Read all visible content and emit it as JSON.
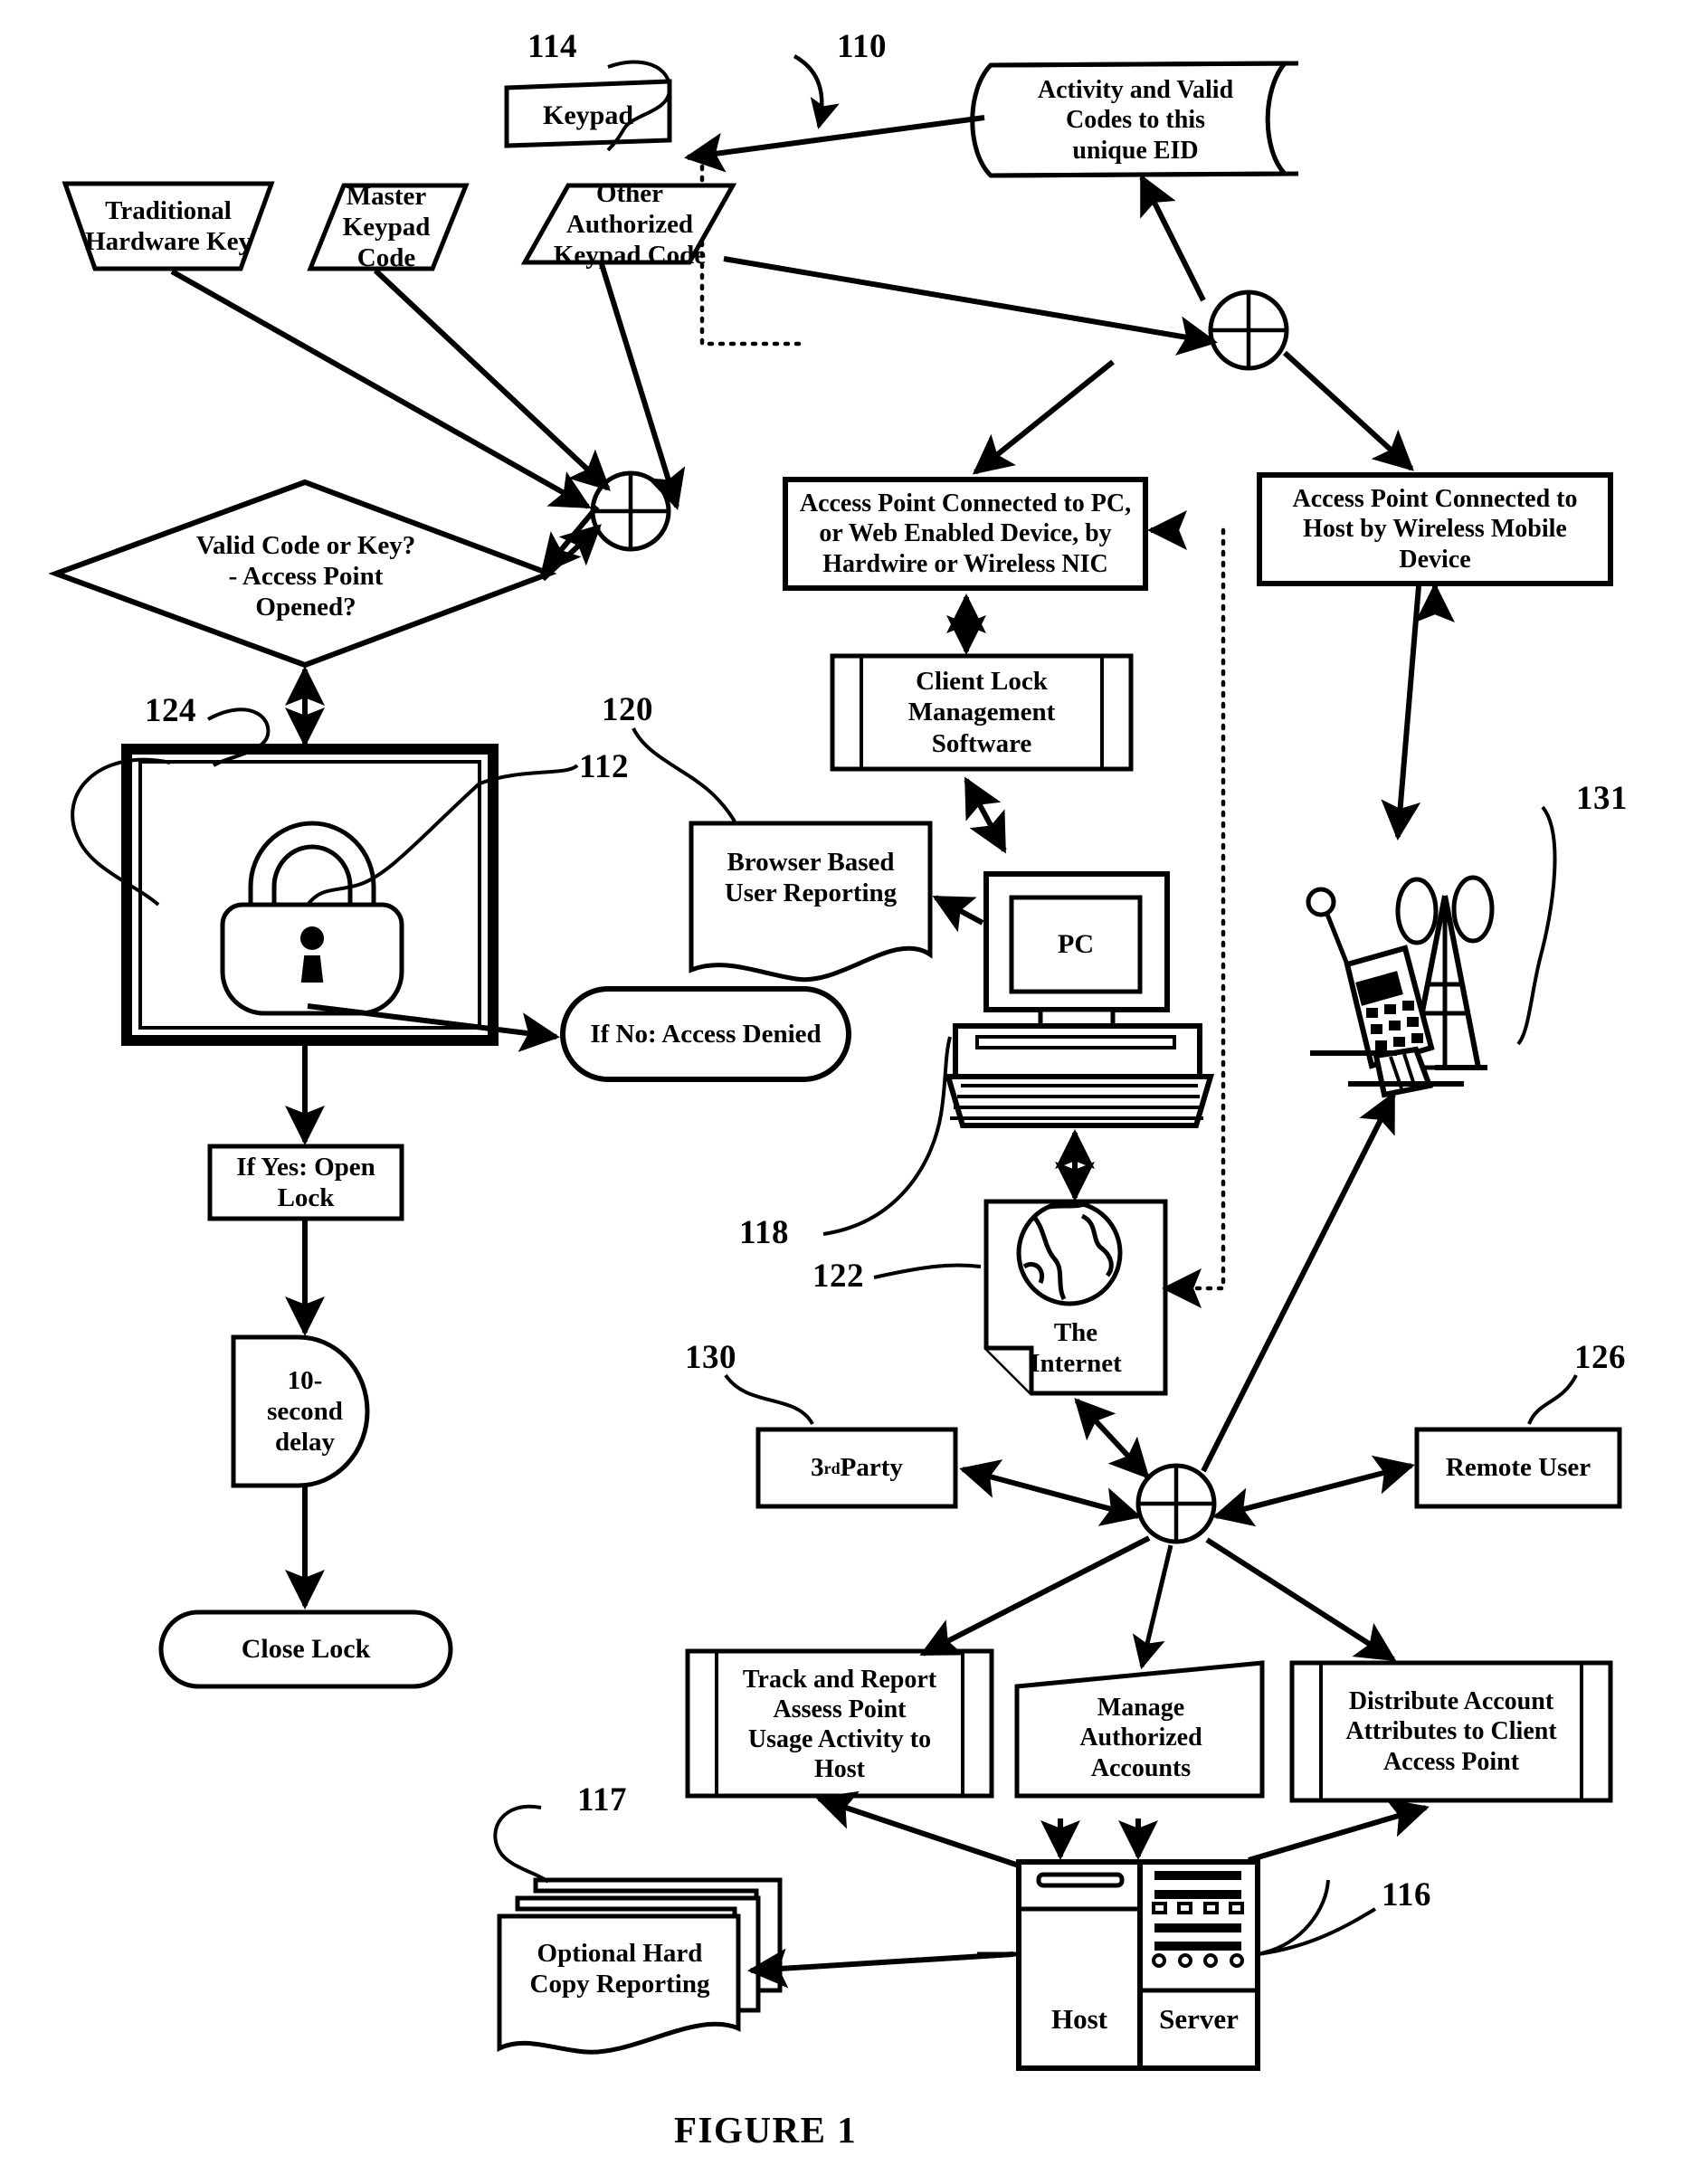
{
  "figure": {
    "caption": "FIGURE 1",
    "title": "Access point lock control and reporting system flow diagram"
  },
  "nodes": {
    "keypad": {
      "label": "Keypad",
      "shape": "skewed-box"
    },
    "activity_codes": {
      "label": "Activity and Valid\nCodes to this\nunique EID",
      "shape": "stored-data"
    },
    "traditional_key": {
      "label": "Traditional\nHardware Key",
      "shape": "trapezoid"
    },
    "master_code": {
      "label": "Master\nKeypad\nCode",
      "shape": "parallelogram"
    },
    "other_code": {
      "label": "Other\nAuthorized\nKeypad Code",
      "shape": "parallelogram"
    },
    "valid_decision": {
      "label": "Valid Code or Key?\n- Access Point\nOpened?",
      "shape": "diamond"
    },
    "lock_box": {
      "label": "",
      "shape": "double-box-with-padlock"
    },
    "access_denied": {
      "label": "If No: Access Denied",
      "shape": "stadium"
    },
    "open_lock": {
      "label": "If Yes: Open\nLock",
      "shape": "rect"
    },
    "delay": {
      "label": "10-\nsecond\ndelay",
      "shape": "delay"
    },
    "close_lock": {
      "label": "Close Lock",
      "shape": "stadium"
    },
    "ap_pc": {
      "label": "Access Point Connected to PC,\nor Web Enabled Device, by\nHardwire or Wireless NIC",
      "shape": "rect"
    },
    "ap_host": {
      "label": "Access Point Connected to\nHost by Wireless Mobile\nDevice",
      "shape": "rect"
    },
    "client_lock_sw": {
      "label": "Client Lock\nManagement\nSoftware",
      "shape": "predefined-process"
    },
    "browser_report": {
      "label": "Browser Based\nUser Reporting",
      "shape": "document"
    },
    "pc": {
      "label": "PC",
      "shape": "pc-icon"
    },
    "internet": {
      "label": "The\nInternet",
      "shape": "page-with-globe"
    },
    "cell_tower": {
      "label": "",
      "shape": "cell-tower-and-phone-icon"
    },
    "third_party": {
      "label": "3",
      "label_ordinal": "rd",
      "label_rest": " Party",
      "shape": "rect"
    },
    "remote_user": {
      "label": "Remote User",
      "shape": "rect"
    },
    "track_report": {
      "label": "Track and Report\nAssess Point\nUsage Activity to\nHost",
      "shape": "predefined-process"
    },
    "manage_accounts": {
      "label": "Manage\nAuthorized\nAccounts",
      "shape": "skewed-quad"
    },
    "distribute_attrs": {
      "label": "Distribute Account\nAttributes to Client\nAccess Point",
      "shape": "predefined-process"
    },
    "host_server_host": {
      "label": "Host",
      "shape": "server-icon"
    },
    "host_server_server": {
      "label": "Server",
      "shape": "server-icon"
    },
    "hard_copy": {
      "label": "Optional Hard\nCopy Reporting",
      "shape": "stacked-documents"
    }
  },
  "reference_numerals": {
    "n110": "110",
    "n112": "112",
    "n114": "114",
    "n116": "116",
    "n117": "117",
    "n118": "118",
    "n120": "120",
    "n122": "122",
    "n124": "124",
    "n126": "126",
    "n130": "130",
    "n131": "131"
  },
  "colors": {
    "stroke": "#000000",
    "fill": "#ffffff",
    "background": "#ffffff"
  }
}
